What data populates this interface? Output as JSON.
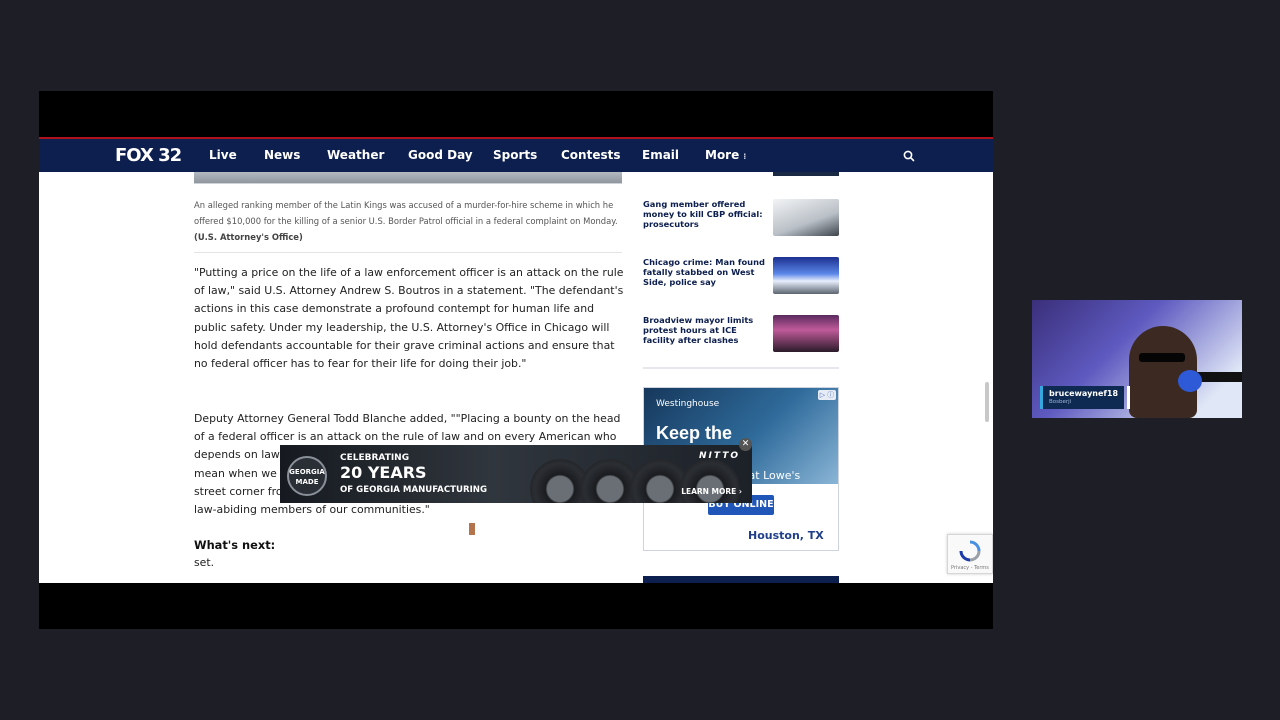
{
  "nav": {
    "logo": "FOX 32",
    "items": [
      "Live",
      "News",
      "Weather",
      "Good Day",
      "Sports",
      "Contests",
      "Email",
      "More"
    ]
  },
  "article": {
    "caption": "An alleged ranking member of the Latin Kings was accused of a murder-for-hire scheme in which he offered $10,000 for the killing of a senior U.S. Border Patrol official in a federal complaint on Monday.",
    "caption_credit": "(U.S. Attorney's Office)",
    "paragraph1": "\"Putting a price on the life of a law enforcement officer is an attack on the rule of law,\" said U.S. Attorney Andrew S. Boutros in a statement. \"The defendant's actions in this case demonstrate a profound contempt for human life and public safety.  Under my leadership, the U.S. Attorney's Office in Chicago will hold defendants accountable for their grave criminal actions and ensure that no federal officer has to fear for their life for doing their job.\"",
    "paragraph2": "Deputy Attorney General Todd Blanche added, \"\"Placing a bounty on the head of a federal officer is an attack on the rule of law and on every American who depends on law enforcement to keep them safe. This case is exactly what we mean when we say Take Back America - taking back every neighborhood and street corner from violent thugs and criminal gangs and returning them to the law-abiding members of our communities.\"",
    "whats_next_label": "What's next:",
    "whats_next_end": "set."
  },
  "sidebar": {
    "stories": [
      {
        "title": "Gang member offered money to kill CBP official: prosecutors",
        "thumb_color": "#d9dde2"
      },
      {
        "title": "Chicago crime: Man found fatally stabbed on West Side, police say",
        "thumb_color": "#2a3b8f"
      },
      {
        "title": "Broadview mayor limits protest hours at ICE facility after clashes",
        "thumb_color": "#4a2340"
      }
    ]
  },
  "side_ad": {
    "brand": "Westinghouse",
    "headline": "Keep the Lights on",
    "sub": "Generators Now at Lowe's",
    "button": "BUY ONLINE",
    "location": "Houston, TX",
    "choices": "▷ ⓘ"
  },
  "banner_ad": {
    "badge": "GEORGIA MADE",
    "line1": "CELEBRATING",
    "line2": "20 YEARS",
    "line3": "OF GEORGIA MANUFACTURING",
    "brand": "NITTO",
    "cta": "LEARN MORE ›",
    "close": "✕"
  },
  "recaptcha": {
    "terms": "Privacy - Terms"
  },
  "webcam": {
    "username": "brucewaynef18",
    "subtitle": "Bosberji"
  },
  "colors": {
    "nav": "#0d1f4e",
    "accent": "#b0121b",
    "link": "#0d1f4e"
  }
}
